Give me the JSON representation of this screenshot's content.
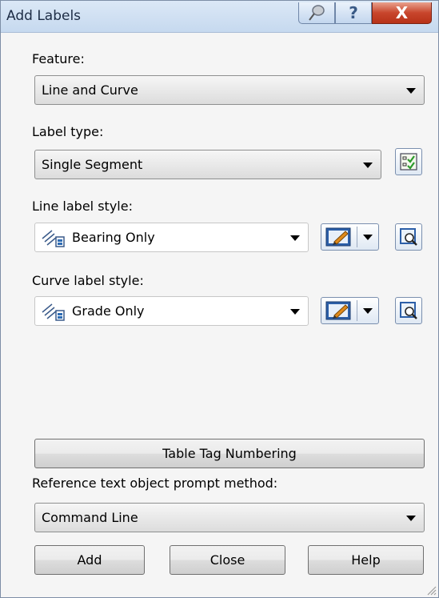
{
  "window": {
    "title": "Add Labels"
  },
  "titlebar": {
    "pin_icon": "pushpin-icon",
    "help_label": "?",
    "close_label": "X"
  },
  "feature": {
    "label": "Feature:",
    "value": "Line and Curve"
  },
  "label_type": {
    "label": "Label type:",
    "value": "Single Segment",
    "button_icon": "checklist-icon"
  },
  "line_label_style": {
    "label": "Line label style:",
    "value": "Bearing Only",
    "style_icon": "label-style-icon",
    "edit_icon": "edit-style-icon",
    "pick_icon": "pick-from-drawing-icon"
  },
  "curve_label_style": {
    "label": "Curve label style:",
    "value": "Grade Only",
    "style_icon": "label-style-icon",
    "edit_icon": "edit-style-icon",
    "pick_icon": "pick-from-drawing-icon"
  },
  "table_tag_button": "Table Tag Numbering",
  "reference_prompt": {
    "label": "Reference text object prompt method:",
    "value": "Command Line"
  },
  "buttons": {
    "add": "Add",
    "close": "Close",
    "help": "Help"
  }
}
